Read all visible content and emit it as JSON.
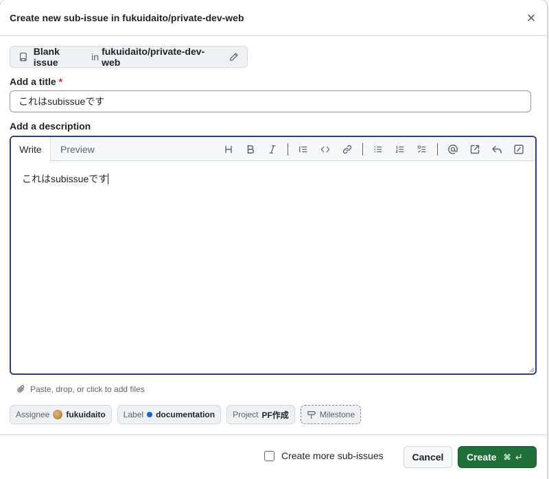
{
  "dialog": {
    "title": "Create new sub-issue in fukuidaito/private-dev-web"
  },
  "template": {
    "name": "Blank issue",
    "in": "in",
    "repo": "fukuidaito/private-dev-web"
  },
  "title_field": {
    "label": "Add a title",
    "required_mark": "*",
    "value": "これはsubissueです"
  },
  "description": {
    "label": "Add a description",
    "tabs": {
      "write": "Write",
      "preview": "Preview"
    },
    "body": "これはsubissueです"
  },
  "attach": {
    "text": "Paste, drop, or click to add files"
  },
  "metadata": {
    "assignee": {
      "label": "Assignee",
      "value": "fukuidaito"
    },
    "label": {
      "label": "Label",
      "value": "documentation",
      "color": "#0969da"
    },
    "project": {
      "label": "Project",
      "value": "PF作成"
    },
    "milestone": {
      "label": "Milestone"
    }
  },
  "footer": {
    "more_label": "Create more sub-issues",
    "cancel": "Cancel",
    "create": "Create",
    "shortcut": "⌘"
  },
  "colors": {
    "primary": "#1f6f38",
    "focus": "#2f3a8f"
  }
}
